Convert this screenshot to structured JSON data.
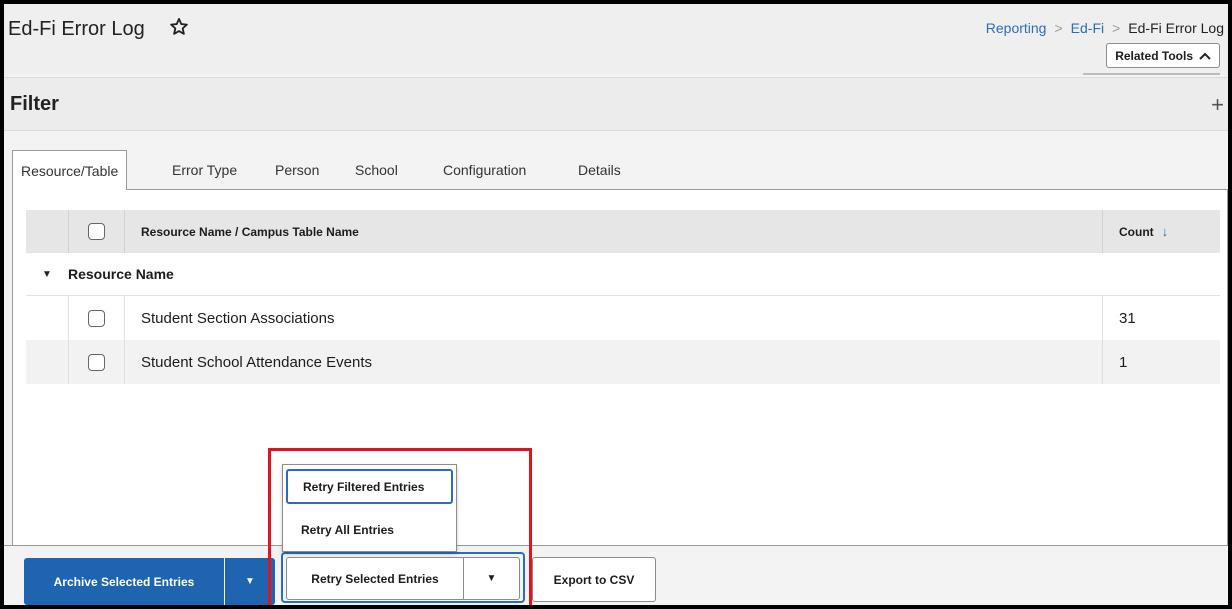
{
  "header": {
    "title": "Ed-Fi Error Log",
    "breadcrumb": {
      "items": [
        "Reporting",
        "Ed-Fi"
      ],
      "current": "Ed-Fi Error Log"
    },
    "related_tools_label": "Related Tools"
  },
  "filter": {
    "title": "Filter"
  },
  "tabs": [
    {
      "label": "Resource/Table"
    },
    {
      "label": "Error Type"
    },
    {
      "label": "Person"
    },
    {
      "label": "School"
    },
    {
      "label": "Configuration"
    },
    {
      "label": "Details"
    }
  ],
  "grid": {
    "header_name": "Resource Name / Campus Table Name",
    "header_count": "Count",
    "group_label": "Resource Name",
    "rows": [
      {
        "name": "Student Section Associations",
        "count": "31"
      },
      {
        "name": "Student School Attendance Events",
        "count": "1"
      }
    ]
  },
  "actions": {
    "archive_label": "Archive Selected Entries",
    "retry_label": "Retry Selected Entries",
    "export_label": "Export to CSV"
  },
  "retry_menu": {
    "items": [
      "Retry Filtered Entries",
      "Retry All Entries"
    ]
  },
  "colors": {
    "primary": "#1f64b1",
    "link": "#2a6ebb",
    "highlight": "#e0141f"
  }
}
